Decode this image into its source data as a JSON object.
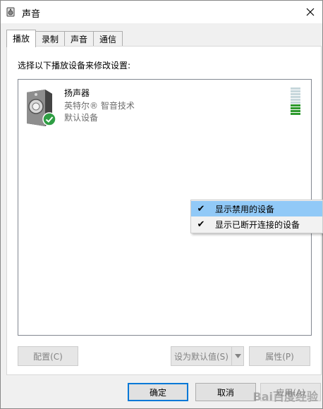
{
  "window": {
    "title": "声音",
    "close_icon": "close-icon"
  },
  "tabs": [
    {
      "label": "播放",
      "active": true
    },
    {
      "label": "录制",
      "active": false
    },
    {
      "label": "声音",
      "active": false
    },
    {
      "label": "通信",
      "active": false
    }
  ],
  "playback": {
    "instruction": "选择以下播放设备来修改设置:",
    "devices": [
      {
        "name": "扬声器",
        "driver": "英特尔® 智音技术",
        "status": "默认设备",
        "icon": "speaker-icon",
        "badge": "default-check-icon",
        "level_bars_total": 10,
        "level_bars_lit": 4
      }
    ]
  },
  "context_menu": {
    "items": [
      {
        "label": "显示禁用的设备",
        "checked": true,
        "highlighted": true
      },
      {
        "label": "显示已断开连接的设备",
        "checked": true,
        "highlighted": false
      }
    ]
  },
  "panel_buttons": {
    "configure": "配置(C)",
    "set_default": "设为默认值(S)",
    "properties": "属性(P)"
  },
  "dialog_buttons": {
    "ok": "确定",
    "cancel": "取消",
    "apply": "应用(A)"
  },
  "colors": {
    "accent": "#0078d7",
    "menu_highlight": "#91c9f7",
    "level_on": "#2e9a2e",
    "check_green": "#2f9e44"
  },
  "watermark": "Bai百度经验"
}
